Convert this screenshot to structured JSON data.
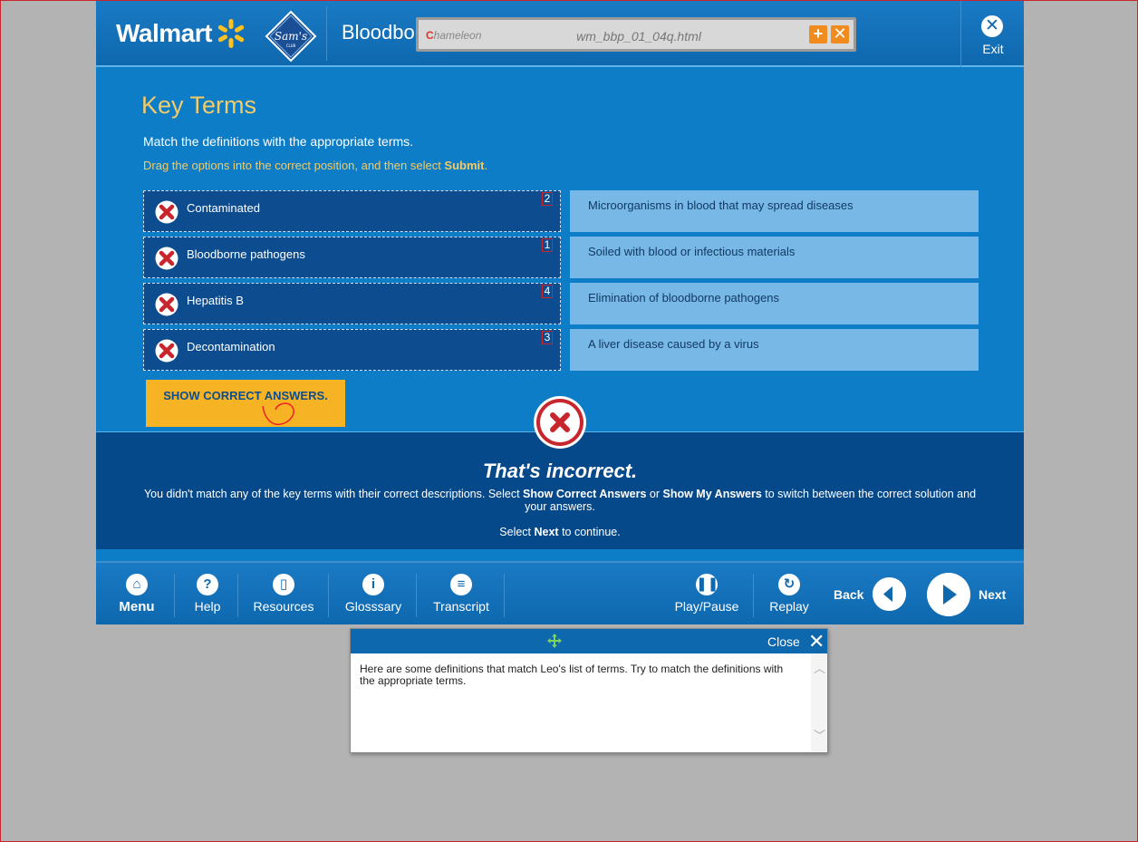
{
  "header": {
    "brand": "Walmart",
    "course_title": "Bloodbo",
    "exit_label": "Exit"
  },
  "overlay": {
    "logo_text": "hameleon",
    "file_name": "wm_bbp_01_04q.html"
  },
  "content": {
    "title": "Key Terms",
    "instruction": "Match the definitions with the appropriate terms.",
    "drag_instruction_prefix": "Drag the options into the correct position, and then select ",
    "drag_instruction_bold": "Submit",
    "drag_instruction_suffix": ".",
    "terms": [
      {
        "label": "Contaminated",
        "number": "2"
      },
      {
        "label": "Bloodborne pathogens",
        "number": "1"
      },
      {
        "label": "Hepatitis B",
        "number": "4"
      },
      {
        "label": "Decontamination",
        "number": "3"
      }
    ],
    "definitions": [
      "Microorganisms in blood that may spread diseases",
      "Soiled with blood or infectious materials",
      "Elimination of bloodborne pathogens",
      "A liver disease caused by a virus"
    ],
    "show_answers_button": "SHOW CORRECT ANSWERS."
  },
  "feedback": {
    "title": "That's incorrect.",
    "text_1": "You didn't match any of the key terms with their correct descriptions.  Select ",
    "text_bold_1": "Show Correct Answers",
    "text_2": " or ",
    "text_bold_2": "Show My Answers",
    "text_3": " to switch between the correct solution and your answers.",
    "next_1": "Select ",
    "next_bold": "Next",
    "next_2": " to continue."
  },
  "footer": {
    "menu": "Menu",
    "help": "Help",
    "resources": "Resources",
    "glossary": "Glosssary",
    "transcript": "Transcript",
    "play_pause": "Play/Pause",
    "replay": "Replay",
    "back": "Back",
    "next": "Next"
  },
  "transcript_popup": {
    "close_label": "Close",
    "text": "Here are some definitions that match Leo's list of terms.  Try to match the definitions with the appropriate terms."
  },
  "colors": {
    "brand_blue": "#0c7dc6",
    "dark_blue": "#0d4d8f",
    "accent_yellow": "#f6b324",
    "heading_gold": "#f2cb6b",
    "error_red": "#c8262c"
  }
}
